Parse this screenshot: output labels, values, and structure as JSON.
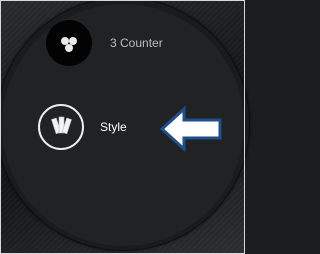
{
  "menu": {
    "items": [
      {
        "label": "3 Counter",
        "icon": "three-dots-icon"
      },
      {
        "label": "Style",
        "icon": "palette-swatch-icon",
        "highlighted": true
      }
    ]
  },
  "annotation": {
    "icon": "left-arrow-icon",
    "color": "#1f4e8c"
  }
}
